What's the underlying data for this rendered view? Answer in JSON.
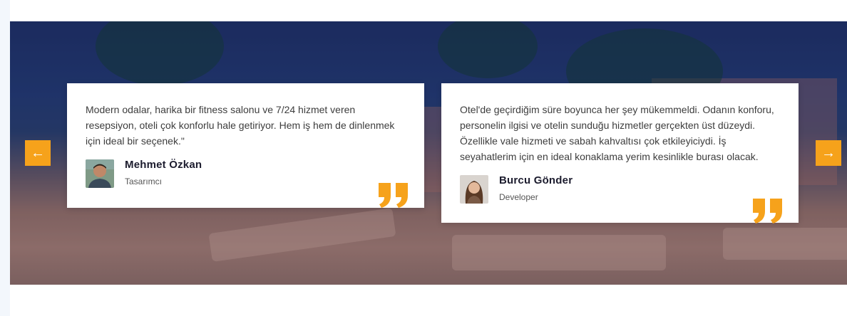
{
  "testimonials": [
    {
      "quote": "Modern odalar, harika bir fitness salonu ve 7/24 hizmet veren resepsiyon, oteli çok konforlu hale getiriyor. Hem iş hem de dinlenmek için ideal bir seçenek.\"",
      "name": "Mehmet Özkan",
      "role": "Tasarımcı",
      "avatar_icon": "male-avatar-photo"
    },
    {
      "quote": "Otel'de geçirdiğim süre boyunca her şey mükemmeldi. Odanın konforu, personelin ilgisi ve otelin sunduğu hizmetler gerçekten üst düzeydi. Özellikle vale hizmeti ve sabah kahvaltısı çok etkileyiciydi. İş seyahatlerim için en ideal konaklama yerim kesinlikle burası olacak.",
      "name": "Burcu Gönder",
      "role": "Developer",
      "avatar_icon": "female-avatar-photo"
    }
  ],
  "nav": {
    "prev_icon": "arrow-left-icon",
    "next_icon": "arrow-right-icon",
    "prev_glyph": "←",
    "next_glyph": "→"
  },
  "colors": {
    "accent": "#f6a21b",
    "card_bg": "#ffffff",
    "name_text": "#1c1c2e"
  }
}
